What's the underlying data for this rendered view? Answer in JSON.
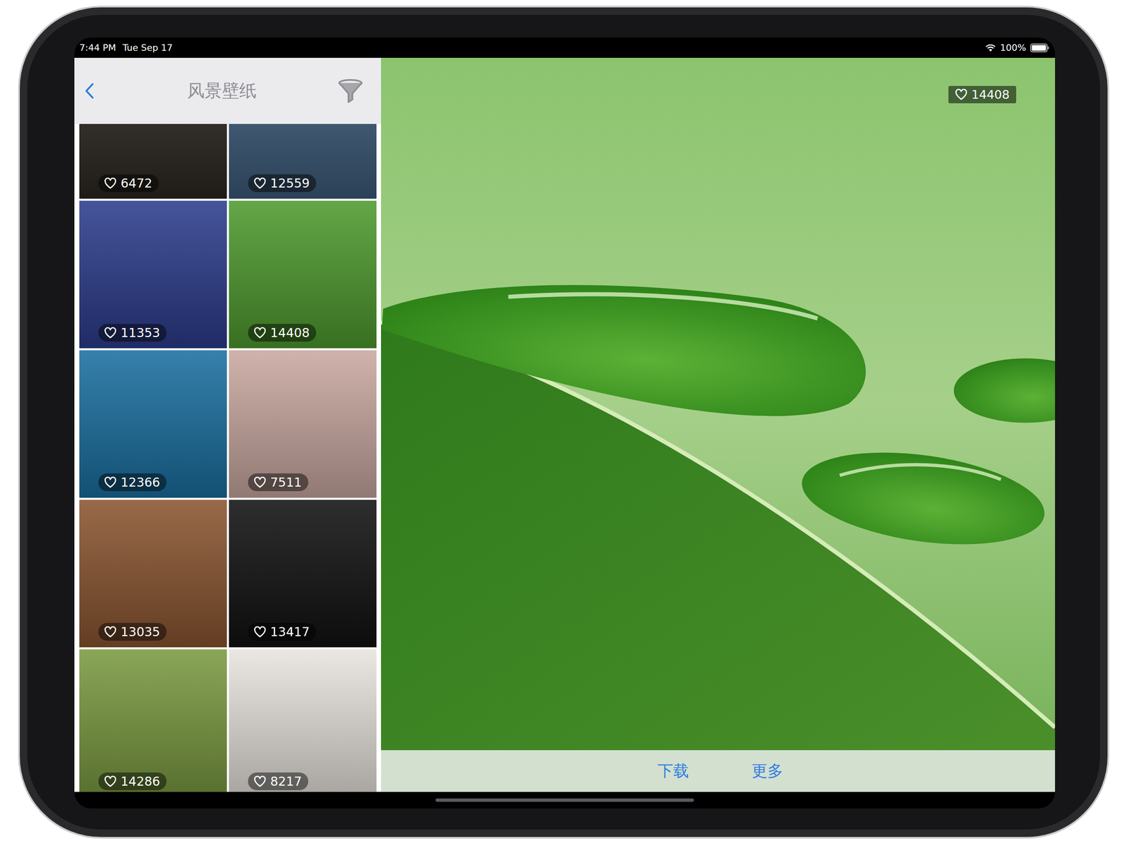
{
  "status_bar": {
    "time": "7:44 PM",
    "date": "Tue Sep 17",
    "battery": "100%",
    "battery_level": 1
  },
  "nav": {
    "title": "风景壁纸"
  },
  "wallpapers": [
    {
      "likes": "6472",
      "color": "#2b2620"
    },
    {
      "likes": "12559",
      "color": "#3b5a78"
    },
    {
      "likes": "11353",
      "color": "#2c3c8c"
    },
    {
      "likes": "14408",
      "color": "#4e9a2e"
    },
    {
      "likes": "12366",
      "color": "#1a6fa0"
    },
    {
      "likes": "7511",
      "color": "#c9a8a0"
    },
    {
      "likes": "13035",
      "color": "#8a5530"
    },
    {
      "likes": "13417",
      "color": "#111111"
    },
    {
      "likes": "14286",
      "color": "#7a9a40"
    },
    {
      "likes": "8217",
      "color": "#e8e4de"
    }
  ],
  "detail": {
    "likes": "14408"
  },
  "toolbar": [
    "下载",
    "更多"
  ]
}
